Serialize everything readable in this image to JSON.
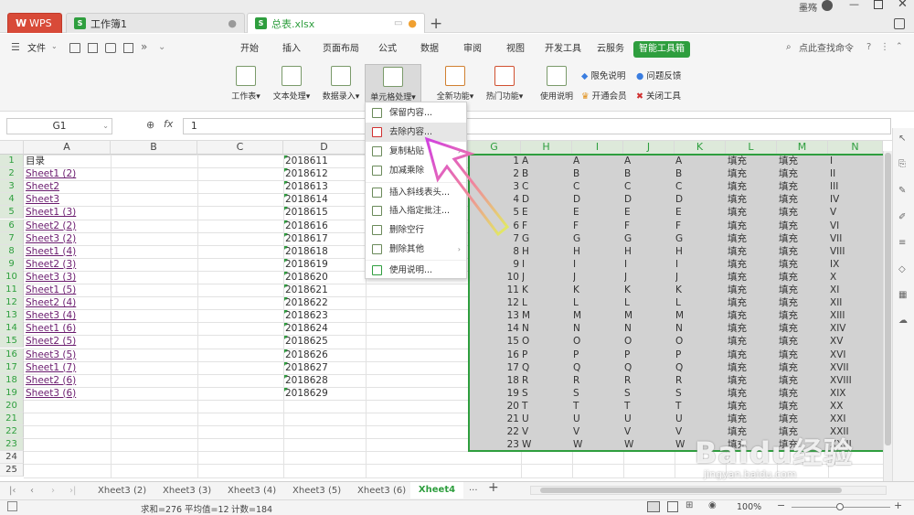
{
  "window": {
    "user": "墨殇"
  },
  "tabs": [
    {
      "label": "WPS"
    },
    {
      "label": "工作簿1"
    },
    {
      "label": "总表.xlsx"
    }
  ],
  "menubar": {
    "file": "文件",
    "items": [
      "开始",
      "插入",
      "页面布局",
      "公式",
      "数据",
      "审阅",
      "视图",
      "开发工具",
      "云服务",
      "智能工具箱"
    ],
    "search": "点此查找命令"
  },
  "ribbon": {
    "buttons": [
      "工作表",
      "文本处理",
      "数据录入",
      "单元格处理",
      "全新功能",
      "热门功能",
      "使用说明"
    ],
    "links": [
      "限免说明",
      "问题反馈",
      "开通会员",
      "关闭工具"
    ]
  },
  "formula": {
    "cell_ref": "G1",
    "fx": "fx",
    "value": "1"
  },
  "columns": [
    "A",
    "B",
    "C",
    "D",
    "G",
    "H",
    "I",
    "J",
    "K",
    "L",
    "M",
    "N"
  ],
  "rows": [
    "1",
    "2",
    "3",
    "4",
    "5",
    "6",
    "7",
    "8",
    "9",
    "10",
    "11",
    "12",
    "13",
    "14",
    "15",
    "16",
    "17",
    "18",
    "19",
    "20",
    "21",
    "22",
    "23",
    "24",
    "25"
  ],
  "col_a": [
    "目录",
    "Sheet1 (2)",
    "Sheet2",
    "Sheet3",
    "Sheet1 (3)",
    "Sheet2 (2)",
    "Sheet3 (2)",
    "Sheet1 (4)",
    "Sheet2 (3)",
    "Sheet3 (3)",
    "Sheet1 (5)",
    "Sheet2 (4)",
    "Sheet3 (4)",
    "Sheet1 (6)",
    "Sheet2 (5)",
    "Sheet3 (5)",
    "Sheet1 (7)",
    "Sheet2 (6)",
    "Sheet3 (6)"
  ],
  "col_d": [
    "2018611",
    "2018612",
    "2018613",
    "2018614",
    "2018615",
    "2018616",
    "2018617",
    "2018618",
    "2018619",
    "2018620",
    "2018621",
    "2018622",
    "2018623",
    "2018624",
    "2018625",
    "2018626",
    "2018627",
    "2018628",
    "2018629"
  ],
  "col_g": [
    "1",
    "2",
    "3",
    "4",
    "5",
    "6",
    "7",
    "8",
    "9",
    "10",
    "11",
    "12",
    "13",
    "14",
    "15",
    "16",
    "17",
    "18",
    "19",
    "20",
    "21",
    "22",
    "23"
  ],
  "letters": [
    "A",
    "B",
    "C",
    "D",
    "E",
    "F",
    "G",
    "H",
    "I",
    "J",
    "K",
    "L",
    "M",
    "N",
    "O",
    "P",
    "Q",
    "R",
    "S",
    "T",
    "U",
    "V",
    "W"
  ],
  "fill": "填充",
  "roman": [
    "I",
    "II",
    "III",
    "IV",
    "V",
    "VI",
    "VII",
    "VIII",
    "IX",
    "X",
    "XI",
    "XII",
    "XIII",
    "XIV",
    "XV",
    "XVI",
    "XVII",
    "XVIII",
    "XIX",
    "XX",
    "XXI",
    "XXII",
    "XXIII"
  ],
  "dropdown": [
    "保留内容...",
    "去除内容...",
    "复制粘贴",
    "加减乘除",
    "插入斜线表头...",
    "插入指定批注...",
    "删除空行",
    "删除其他",
    "使用说明..."
  ],
  "sheet_tabs": [
    "Xheet3 (2)",
    "Xheet3 (3)",
    "Xheet3 (4)",
    "Xheet3 (5)",
    "Xheet3 (6)",
    "Xheet4"
  ],
  "status": {
    "sum": "求和=276",
    "avg": "平均值=12",
    "count": "计数=184",
    "zoom": "100%"
  },
  "watermark": "Baidu经验",
  "watermark_url": "jingyan.baidu.com",
  "colors": {
    "accent": "#2e9e3e",
    "selection": "#d2d2d2",
    "link": "#6a1b6e"
  }
}
